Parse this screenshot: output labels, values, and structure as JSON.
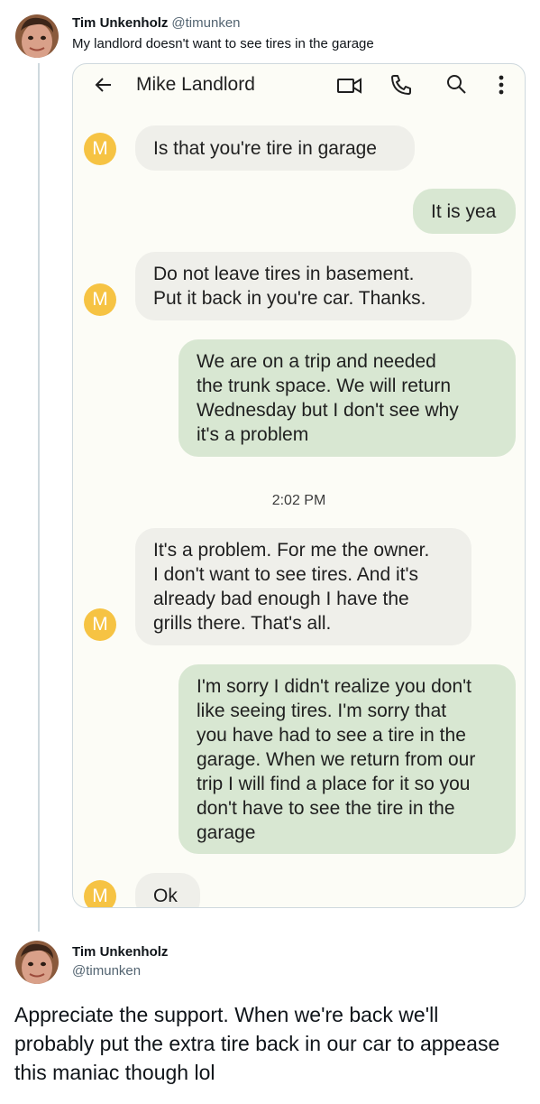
{
  "tweet1": {
    "author_name": "Tim Unkenholz",
    "author_handle": "@timunken",
    "text": "My landlord doesn't want to see tires in the garage"
  },
  "conversation": {
    "contact_name": "Mike Landlord",
    "contact_initial": "M",
    "icons": [
      "back-arrow-icon",
      "video-call-icon",
      "phone-icon",
      "search-icon",
      "more-vert-icon"
    ],
    "timestamp": "2:02 PM",
    "messages": [
      {
        "from": "landlord",
        "lines": [
          "Is that you're tire in garage"
        ]
      },
      {
        "from": "me",
        "lines": [
          "It is yea"
        ]
      },
      {
        "from": "landlord",
        "lines": [
          "Do not leave tires in basement.",
          "Put it back in you're car. Thanks."
        ]
      },
      {
        "from": "me",
        "lines": [
          "We are on a trip and needed",
          "the trunk space. We will return",
          "Wednesday but I don't see why",
          "it's a problem"
        ]
      },
      {
        "from": "landlord",
        "lines": [
          "It's a problem. For me the owner.",
          "I don't want to see tires. And it's",
          "already bad enough I have the",
          "grills there. That's all."
        ]
      },
      {
        "from": "me",
        "lines": [
          "I'm sorry I didn't realize you don't",
          "like seeing tires. I'm sorry that",
          "you have had to see a tire in the",
          "garage. When we return from our",
          "trip I will find a place for it so you",
          "don't have to see the tire in the",
          "garage"
        ]
      },
      {
        "from": "landlord",
        "lines": [
          "Ok"
        ]
      }
    ]
  },
  "tweet2": {
    "author_name": "Tim Unkenholz",
    "author_handle": "@timunken",
    "text": "Appreciate the support. When we're back we'll probably put the extra tire back in our car to appease this maniac though lol"
  },
  "colors": {
    "landlord_avatar": "#f6c343",
    "incoming_bubble": "#efefea",
    "outgoing_bubble": "#d8e7d2",
    "thread_line": "#cfd9de",
    "handle_text": "#536471"
  }
}
